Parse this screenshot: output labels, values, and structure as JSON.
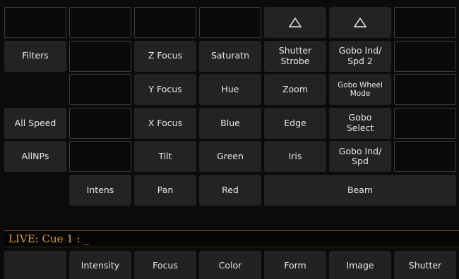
{
  "grid": {
    "rows": [
      [
        "",
        "",
        "",
        "",
        "up-arrow",
        "up-arrow",
        ""
      ],
      [
        "Filters",
        "",
        "Z Focus",
        "Saturatn",
        "Shutter\nStrobe",
        "Gobo Ind/\nSpd 2",
        ""
      ],
      [
        "",
        "",
        "Y Focus",
        "Hue",
        "Zoom",
        "Gobo Wheel\nMode",
        ""
      ],
      [
        "All Speed",
        "",
        "X Focus",
        "Blue",
        "Edge",
        "Gobo\nSelect",
        ""
      ],
      [
        "AllNPs",
        "",
        "Tilt",
        "Green",
        "Iris",
        "Gobo Ind/\nSpd",
        ""
      ],
      [
        "",
        "Intens",
        "Pan",
        "Red",
        "Beam"
      ]
    ]
  },
  "command_line": "LIVE: Cue  1 :  _",
  "tabs": [
    "",
    "Intensity",
    "Focus",
    "Color",
    "Form",
    "Image",
    "Shutter"
  ],
  "icons": {
    "up_arrow": "triangle-up-outline"
  }
}
